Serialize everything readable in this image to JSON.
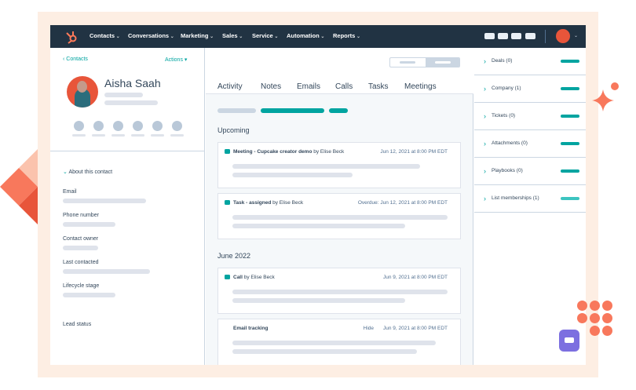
{
  "nav": {
    "items": [
      "Contacts",
      "Conversations",
      "Marketing",
      "Sales",
      "Service",
      "Automation",
      "Reports"
    ]
  },
  "left": {
    "back": "Contacts",
    "actions": "Actions",
    "name": "Aisha Saah",
    "about": "About this contact",
    "fields": [
      "Email",
      "Phone number",
      "Contact owner",
      "Last contacted",
      "Lifecycle stage",
      "Lead status"
    ]
  },
  "tabs": [
    "Activity",
    "Notes",
    "Emails",
    "Calls",
    "Tasks",
    "Meetings"
  ],
  "sections": {
    "upcoming": "Upcoming",
    "june": "June 2022"
  },
  "cards": [
    {
      "type": "Meeting - Cupcake creator demo",
      "by": "by Elise Beck",
      "date": "Jun 12, 2021 at 8:00 PM EDT"
    },
    {
      "type": "Task - assigned",
      "by": "by Elise Beck",
      "date": "Overdue: Jun 12, 2021 at 8:00 PM EDT"
    },
    {
      "type": "Call",
      "by": "by Elise Beck",
      "date": "Jun 9, 2021 at 8:00 PM EDT"
    },
    {
      "type": "Email tracking",
      "hide": "Hide",
      "date": "Jun 9, 2021 at 8:00 PM EDT"
    }
  ],
  "right": [
    "Deals (0)",
    "Company (1)",
    "Tickets (0)",
    "Attachments (0)",
    "Playbooks (0)",
    "List memberships (1)"
  ],
  "colors": {
    "accent": "#00a4a0",
    "nav": "#213343",
    "brand": "#ff7a59"
  }
}
